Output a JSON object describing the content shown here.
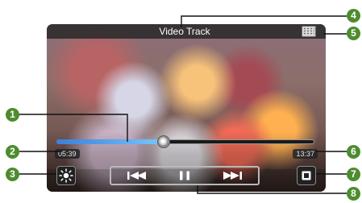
{
  "player": {
    "title": "Video Track",
    "elapsed_time": "05:39",
    "total_time": "13:37",
    "progress_fraction": 0.415
  },
  "icons": {
    "grid": "grid-icon",
    "brightness": "brightness-icon",
    "previous": "previous-track-icon",
    "pause": "pause-icon",
    "next": "next-track-icon",
    "stop": "stop-icon"
  },
  "callouts": [
    "1",
    "2",
    "3",
    "4",
    "5",
    "6",
    "7",
    "8"
  ],
  "colors": {
    "callout_green": "#4d8c2f",
    "progress_blue": "#3a80d8"
  }
}
